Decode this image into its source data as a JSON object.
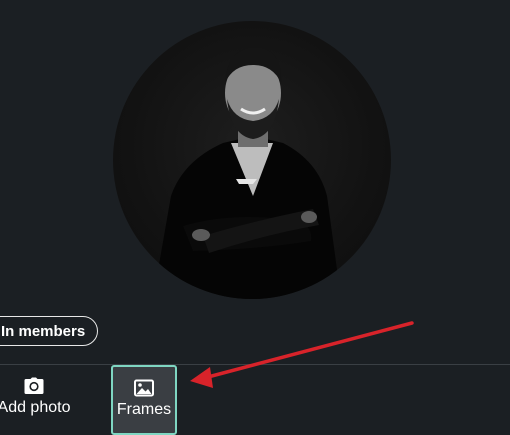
{
  "profile_photo": {
    "alt": "Profile photo of a smiling man in a dark suit with arms crossed"
  },
  "visibility": {
    "label": "In members"
  },
  "actions": {
    "add_photo": {
      "label": "Add photo",
      "icon": "camera-icon"
    },
    "frames": {
      "label": "Frames",
      "icon": "image-icon"
    }
  },
  "colors": {
    "background": "#1b1f23",
    "frames_highlight_border": "#7fd6c2",
    "annotation_arrow": "#d8232a"
  }
}
